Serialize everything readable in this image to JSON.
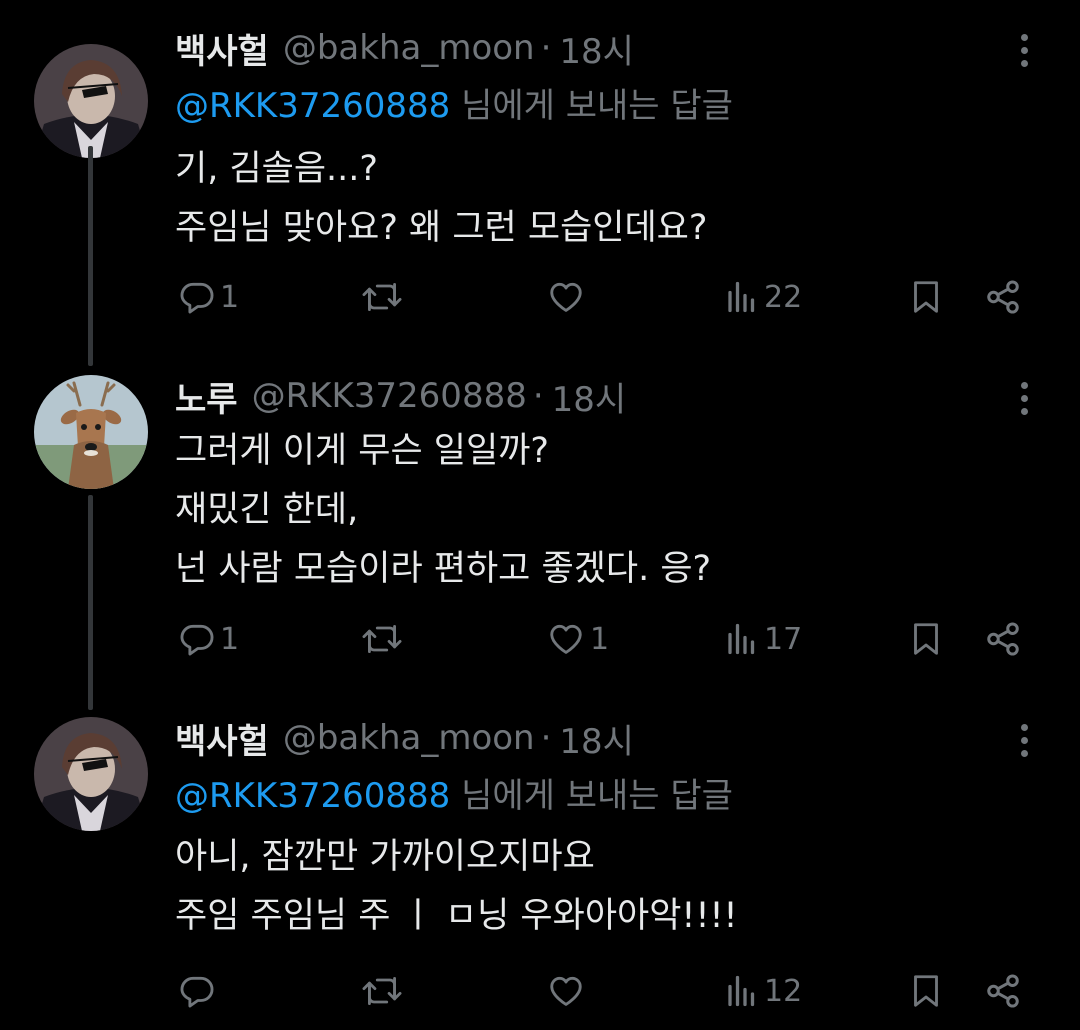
{
  "tweets": [
    {
      "name": "백사헐",
      "handle": "@bakha_moon",
      "dot": "·",
      "time": "18시",
      "reply_mention": "@RKK37260888",
      "reply_suffix": "님에게 보내는 답글",
      "lines": [
        "기, 김솔음...?",
        "주임님 맞아요? 왜 그런 모습인데요?"
      ],
      "stats": {
        "replies": "1",
        "retweets": "",
        "likes": "",
        "views": "22"
      }
    },
    {
      "name": "노루",
      "handle": "@RKK37260888",
      "dot": "·",
      "time": "18시",
      "lines": [
        "그러게 이게 무슨 일일까?",
        "재밌긴 한데,",
        "넌 사람 모습이라 편하고 좋겠다. 응?"
      ],
      "stats": {
        "replies": "1",
        "retweets": "",
        "likes": "1",
        "views": "17"
      }
    },
    {
      "name": "백사헐",
      "handle": "@bakha_moon",
      "dot": "·",
      "time": "18시",
      "reply_mention": "@RKK37260888",
      "reply_suffix": "님에게 보내는 답글",
      "lines": [
        "아니, 잠깐만 가까이오지마요",
        "주임 주임님 주 ㅣ ㅁ닝 우와아아악!!!!"
      ],
      "stats": {
        "replies": "",
        "retweets": "",
        "likes": "",
        "views": "12"
      }
    }
  ],
  "icons": {
    "reply": "reply-icon",
    "retweet": "retweet-icon",
    "like": "like-icon",
    "views": "views-icon",
    "bookmark": "bookmark-icon",
    "share": "share-icon",
    "more": "more-icon"
  },
  "colors": {
    "background": "#000000",
    "text": "#e7e9ea",
    "muted": "#71767b",
    "link": "#1d9bf0",
    "thread_line": "#333639"
  }
}
